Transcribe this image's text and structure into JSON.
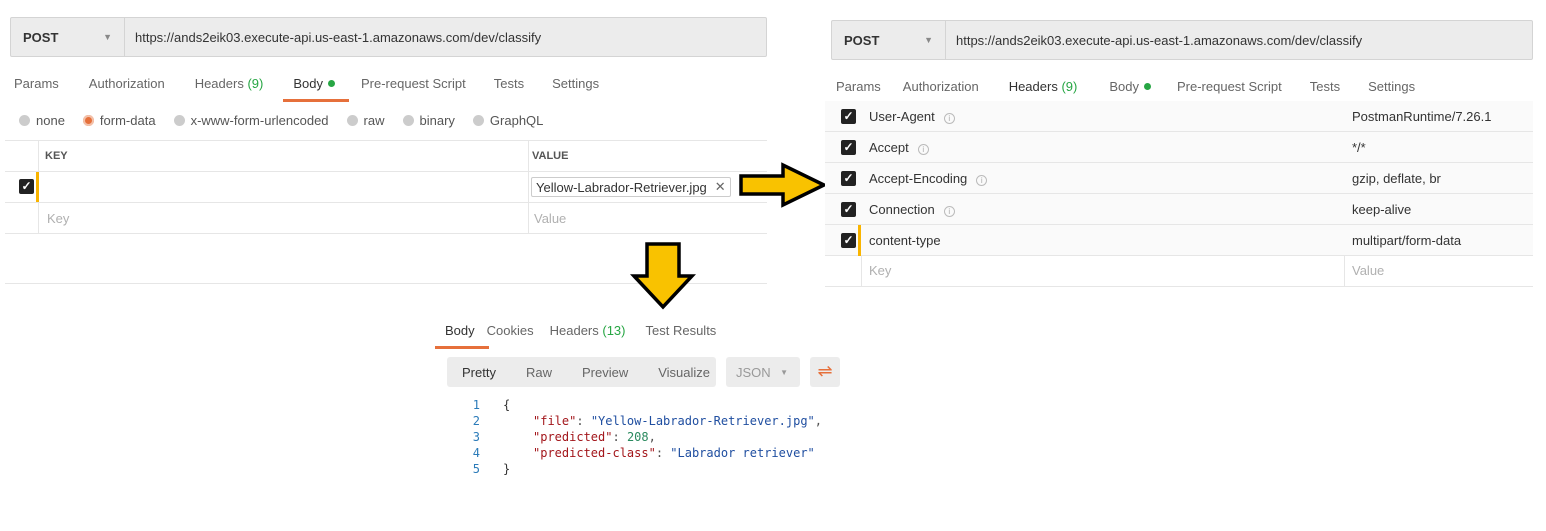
{
  "left_panel": {
    "method": "POST",
    "url": "https://ands2eik03.execute-api.us-east-1.amazonaws.com/dev/classify",
    "tabs": [
      {
        "label": "Params"
      },
      {
        "label": "Authorization"
      },
      {
        "label": "Headers",
        "count": "(9)"
      },
      {
        "label": "Body",
        "active": true
      },
      {
        "label": "Pre-request Script"
      },
      {
        "label": "Tests"
      },
      {
        "label": "Settings"
      }
    ],
    "body_types": [
      "none",
      "form-data",
      "x-www-form-urlencoded",
      "raw",
      "binary",
      "GraphQL"
    ],
    "selected_body_type": "form-data",
    "table": {
      "key_header": "KEY",
      "value_header": "VALUE",
      "rows": [
        {
          "checked": true,
          "key": "",
          "value": "Yellow-Labrador-Retriever.jpg"
        }
      ],
      "key_placeholder": "Key",
      "value_placeholder": "Value"
    }
  },
  "right_panel": {
    "method": "POST",
    "url": "https://ands2eik03.execute-api.us-east-1.amazonaws.com/dev/classify",
    "tabs": [
      {
        "label": "Params"
      },
      {
        "label": "Authorization"
      },
      {
        "label": "Headers",
        "count": "(9)",
        "active": true
      },
      {
        "label": "Body"
      },
      {
        "label": "Pre-request Script"
      },
      {
        "label": "Tests"
      },
      {
        "label": "Settings"
      }
    ],
    "headers": [
      {
        "key": "User-Agent",
        "value": "PostmanRuntime/7.26.1",
        "info": true
      },
      {
        "key": "Accept",
        "value": "*/*",
        "info": true
      },
      {
        "key": "Accept-Encoding",
        "value": "gzip, deflate, br",
        "info": true
      },
      {
        "key": "Connection",
        "value": "keep-alive",
        "info": true
      },
      {
        "key": "content-type",
        "value": "multipart/form-data",
        "info": false
      }
    ],
    "key_placeholder": "Key",
    "value_placeholder": "Value"
  },
  "response": {
    "tabs": [
      {
        "label": "Body",
        "active": true
      },
      {
        "label": "Cookies"
      },
      {
        "label": "Headers",
        "count": "(13)"
      },
      {
        "label": "Test Results"
      }
    ],
    "view_modes": [
      "Pretty",
      "Raw",
      "Preview",
      "Visualize"
    ],
    "format": "JSON",
    "lines": [
      "1",
      "2",
      "3",
      "4",
      "5"
    ],
    "json": {
      "open": "{",
      "file_key": "\"file\"",
      "file_val": "\"Yellow-Labrador-Retriever.jpg\"",
      "pred_key": "\"predicted\"",
      "pred_val": "208",
      "cls_key": "\"predicted-class\"",
      "cls_val": "\"Labrador retriever\"",
      "close": "}"
    }
  },
  "colors": {
    "accent": "#e6703b",
    "success": "#27a644",
    "arrow": "#f9c200"
  }
}
